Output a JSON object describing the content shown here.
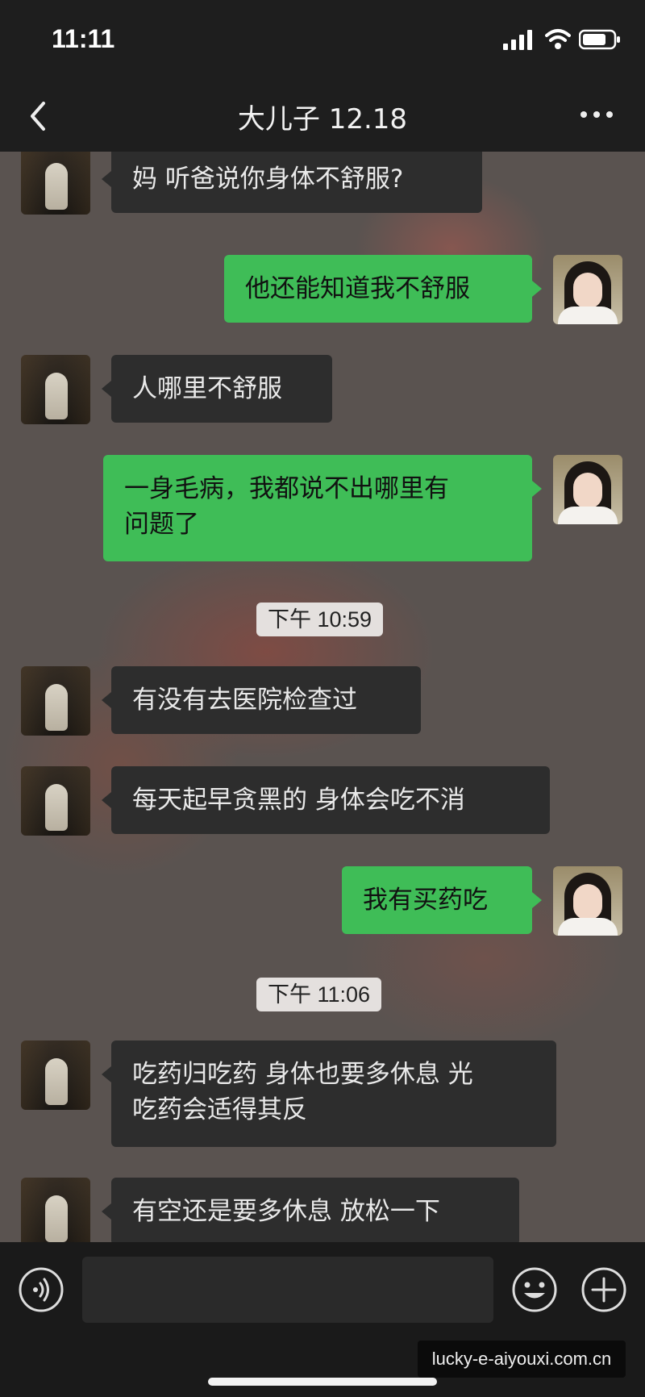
{
  "status_bar": {
    "time": "11:11",
    "icons": [
      "signal-icon",
      "wifi-icon",
      "battery-icon"
    ]
  },
  "nav": {
    "title": "大儿子 12.18",
    "back_icon": "back-icon",
    "more_icon": "more-icon"
  },
  "messages": [
    {
      "side": "left",
      "text": "妈 听爸说你身体不舒服?"
    },
    {
      "side": "right",
      "text": "他还能知道我不舒服"
    },
    {
      "side": "left",
      "text": "人哪里不舒服"
    },
    {
      "side": "right",
      "text": "一身毛病，我都说不出哪里有\n问题了"
    },
    {
      "side": "time",
      "text": "下午 10:59"
    },
    {
      "side": "left",
      "text": "有没有去医院检查过"
    },
    {
      "side": "left",
      "text": "每天起早贪黑的 身体会吃不消"
    },
    {
      "side": "right",
      "text": "我有买药吃"
    },
    {
      "side": "time",
      "text": "下午 11:06"
    },
    {
      "side": "left",
      "text": "吃药归吃药 身体也要多休息 光\n吃药会适得其反"
    },
    {
      "side": "left",
      "text": "有空还是要多休息 放松一下"
    }
  ],
  "input_bar": {
    "placeholder": "",
    "icons": [
      "voice-icon",
      "emoji-icon",
      "plus-icon"
    ]
  },
  "watermark": "lucky-e-aiyouxi.com.cn",
  "colors": {
    "incoming_bubble": "#2d2d2d",
    "outgoing_bubble": "#3fbd57",
    "bar_background": "#1e1e1e"
  }
}
